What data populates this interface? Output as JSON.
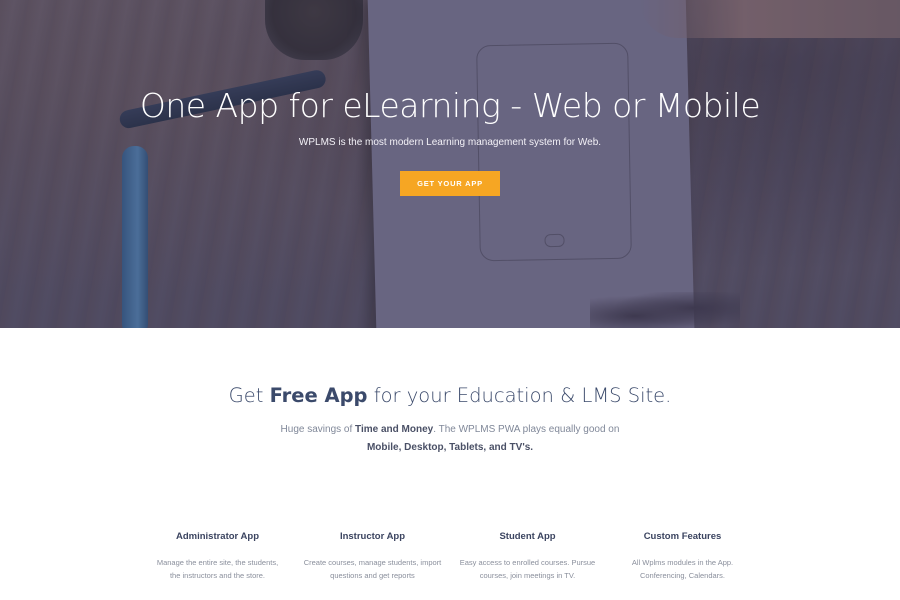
{
  "hero": {
    "title": "One App for eLearning - Web or Mobile",
    "subtitle": "WPLMS is the most modern Learning management system for Web.",
    "cta_label": "GET YOUR APP",
    "cta_color": "#f6a623"
  },
  "intro": {
    "title_prefix": "Get ",
    "title_bold": "Free App",
    "title_suffix": " for your Education & LMS Site.",
    "line1_prefix": "Huge savings of ",
    "line1_bold": "Time and Money",
    "line1_suffix": ". The WPLMS PWA plays equally good on",
    "line2_bold": "Mobile, Desktop, Tablets, and TV's."
  },
  "features": [
    {
      "title": "Administrator App",
      "line1": "Manage the entire site, the students,",
      "line2": "the instructors and the store."
    },
    {
      "title": "Instructor App",
      "line1": "Create courses, manage students, import",
      "line2": "questions and get reports"
    },
    {
      "title": "Student App",
      "line1": "Easy access to enrolled courses. Pursue",
      "line2": "courses, join meetings in TV."
    },
    {
      "title": "Custom Features",
      "line1": "All Wplms modules in the App.",
      "line2": "Conferencing, Calendars."
    }
  ]
}
